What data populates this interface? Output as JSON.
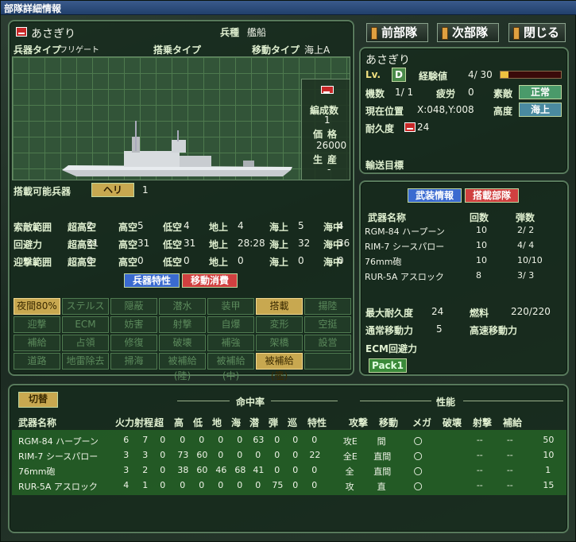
{
  "window": {
    "title": "部隊詳細情報"
  },
  "buttons": {
    "prev": "前部隊",
    "next": "次部隊",
    "close": "閉じる"
  },
  "unit": {
    "name": "あさぎり",
    "category_label": "兵種",
    "category": "艦船",
    "weapon_type_label": "兵器タイプ",
    "weapon_type": "フリゲート",
    "carrier_type_label": "搭乗タイプ",
    "move_type_label": "移動タイプ",
    "move_type": "海上A",
    "formation_label": "編成数",
    "formation": "1",
    "price_label": "価格",
    "price": "26000",
    "production_label": "生産",
    "production": "-",
    "carry_label": "搭載可能兵器",
    "carry_badge": "ヘリ",
    "carry_value": "1"
  },
  "ranges": [
    {
      "label": "索敵範囲",
      "cols": [
        "超高空",
        "2",
        "高空",
        "5",
        "低空",
        "4",
        "地上",
        "4",
        "海上",
        "5",
        "海中",
        "4"
      ]
    },
    {
      "label": "回避力",
      "cols": [
        "超高空",
        "31",
        "高空",
        "31",
        "低空",
        "31",
        "地上",
        "28:28",
        "海上",
        "32",
        "海中",
        "36"
      ]
    },
    {
      "label": "迎撃範囲",
      "cols": [
        "超高空",
        "0",
        "高空",
        "0",
        "低空",
        "0",
        "地上",
        "0",
        "海上",
        "0",
        "海中",
        "0"
      ]
    }
  ],
  "tabs_left": {
    "traits": "兵器特性",
    "move_cost": "移動消費"
  },
  "skills": [
    [
      "夜間80%",
      "ステルス",
      "隠蔽",
      "潜水",
      "装甲",
      "搭載",
      "揚陸"
    ],
    [
      "迎撃",
      "ECM",
      "妨害",
      "射撃",
      "自爆",
      "変形",
      "空挺"
    ],
    [
      "補給",
      "占領",
      "修復",
      "破壊",
      "補強",
      "架橋",
      "設営"
    ],
    [
      "道路",
      "地雷除去",
      "掃海",
      "被補給(陸)",
      "被補給(中)",
      "被補給(艦)",
      ""
    ]
  ],
  "status": {
    "name": "あさぎり",
    "lv_label": "Lv.",
    "lv": "D",
    "exp_label": "経験値",
    "exp": "4/ 30",
    "count_label": "機数",
    "count": "1/ 1",
    "fatigue_label": "疲労",
    "fatigue": "0",
    "morale_label": "素敵",
    "morale": "正常",
    "pos_label": "現在位置",
    "pos": "X:048,Y:008",
    "alt_label": "高度",
    "alt": "海上",
    "dur_label": "耐久度",
    "dur": "24",
    "dest_label": "輸送目標"
  },
  "equip": {
    "tab_weapons": "武装情報",
    "tab_carrier": "搭載部隊",
    "headers": [
      "武器名称",
      "回数",
      "弾数"
    ],
    "rows": [
      [
        "RGM-84 ハープーン",
        "10",
        "2/ 2"
      ],
      [
        "RIM-7 シースパロー",
        "10",
        "4/ 4"
      ],
      [
        "76mm砲",
        "10",
        "10/10"
      ],
      [
        "RUR-5A アスロック",
        "8",
        "3/ 3"
      ]
    ],
    "max_dur_label": "最大耐久度",
    "max_dur": "24",
    "fuel_label": "燃料",
    "fuel": "220/220",
    "normal_move_label": "通常移動力",
    "normal_move": "5",
    "fast_move_label": "高速移動力",
    "ecm_label": "ECM回避力",
    "pack": "Pack1"
  },
  "bottom": {
    "switch": "切替",
    "accuracy_label": "命中率",
    "perf_label": "性能",
    "headers": [
      "武器名称",
      "火力",
      "射程",
      "超",
      "高",
      "低",
      "地",
      "海",
      "潜",
      "弾",
      "巡",
      "特性",
      "攻撃",
      "移動",
      "メガ",
      "破壊",
      "射撃",
      "補給"
    ],
    "rows": [
      [
        "RGM-84 ハープーン",
        "6",
        "7",
        "0",
        "0",
        "0",
        "0",
        "0",
        "63",
        "0",
        "0",
        "0",
        "攻E",
        "間",
        "〇",
        "",
        "--",
        "--",
        "50"
      ],
      [
        "RIM-7 シースパロー",
        "3",
        "3",
        "0",
        "73",
        "60",
        "0",
        "0",
        "0",
        "0",
        "0",
        "22",
        "全E",
        "直間",
        "〇",
        "",
        "--",
        "--",
        "10"
      ],
      [
        "76mm砲",
        "3",
        "2",
        "0",
        "38",
        "60",
        "46",
        "68",
        "41",
        "0",
        "0",
        "0",
        "全",
        "直間",
        "〇",
        "",
        "--",
        "--",
        "1"
      ],
      [
        "RUR-5A アスロック",
        "4",
        "1",
        "0",
        "0",
        "0",
        "0",
        "0",
        "0",
        "75",
        "0",
        "0",
        "攻",
        "直",
        "〇",
        "",
        "--",
        "--",
        "15"
      ]
    ]
  },
  "colors": {
    "panel_border": "#587a5c",
    "highlight": "#c8a850",
    "tab_blue": "#3a6ad0",
    "tab_red": "#d04040"
  }
}
